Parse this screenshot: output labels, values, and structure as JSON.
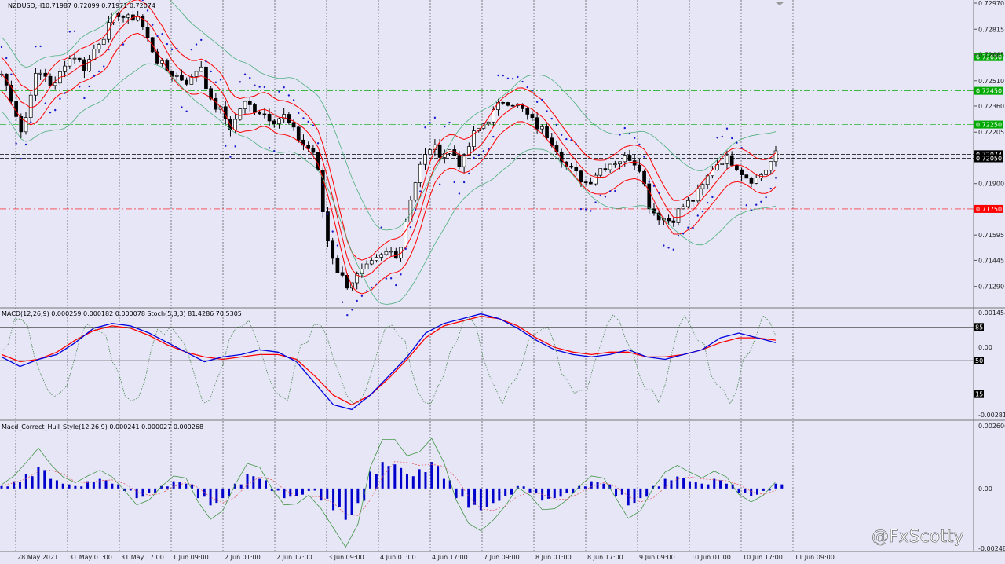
{
  "window": {
    "symbol_header": "NZDUSD,H1",
    "ohlc": "0.71987 0.72099 0.71971 0.72074"
  },
  "indicators": {
    "macd_stoch_header": "MACD(12,26,9) 0.000259 0.000182 0.000078  Stoch(5,3,3) 81.4286 70.5305",
    "macd_hull_header": "Macd_Correct_Hull_Style(12,26,9) 0.000241 0.000027 0.000268"
  },
  "watermark": "@FxScotty",
  "colors": {
    "background": "#e6e6f7",
    "grid": "#555555",
    "candle": "#000000",
    "envelope": "#ff0000",
    "bollinger": "#4caf7a",
    "psar": "#1a1acc",
    "macd_main": "#0000dd",
    "macd_signal": "#ff0000",
    "histogram": "#0000cc",
    "green_level": "#00aa00",
    "red_level": "#ff0000"
  },
  "chart_data": [
    {
      "type": "candlestick",
      "symbol": "NZDUSD",
      "timeframe": "H1",
      "ylim": [
        0.712,
        0.7297
      ],
      "y_ticks": [
        "0.72970",
        "0.72815",
        "0.72665",
        "0.72510",
        "0.72360",
        "0.72205",
        "0.71900",
        "0.71595",
        "0.71445",
        "0.71290"
      ],
      "x_ticks": [
        "28 May 2021",
        "31 May 01:00",
        "31 May 17:00",
        "1 Jun 09:00",
        "2 Jun 01:00",
        "2 Jun 17:00",
        "3 Jun 09:00",
        "4 Jun 01:00",
        "4 Jun 17:00",
        "7 Jun 09:00",
        "8 Jun 01:00",
        "8 Jun 17:00",
        "9 Jun 09:00",
        "10 Jun 01:00",
        "10 Jun 17:00",
        "11 Jun 09:00"
      ],
      "levels": [
        {
          "price": 0.7265,
          "label": "0.72650",
          "color": "#00aa00"
        },
        {
          "price": 0.7245,
          "label": "0.72450",
          "color": "#00aa00"
        },
        {
          "price": 0.7225,
          "label": "0.72250",
          "color": "#00aa00"
        },
        {
          "price": 0.7175,
          "label": "0.71750",
          "color": "#ff0000"
        },
        {
          "price": 0.72074,
          "label": "0.72074",
          "color": "#000000"
        },
        {
          "price": 0.7205,
          "label": "0.72050",
          "color": "#000000"
        }
      ],
      "close_path": [
        0.7255,
        0.724,
        0.7218,
        0.7252,
        0.7256,
        0.7246,
        0.7262,
        0.7266,
        0.7258,
        0.7272,
        0.728,
        0.7292,
        0.7287,
        0.729,
        0.7275,
        0.7262,
        0.7256,
        0.7253,
        0.725,
        0.7262,
        0.7238,
        0.7233,
        0.7222,
        0.7238,
        0.7235,
        0.7232,
        0.7228,
        0.723,
        0.722,
        0.7212,
        0.7208,
        0.716,
        0.714,
        0.713,
        0.7135,
        0.714,
        0.7145,
        0.715,
        0.7148,
        0.718,
        0.72,
        0.7212,
        0.7208,
        0.721,
        0.72,
        0.7218,
        0.7225,
        0.7232,
        0.724,
        0.7238,
        0.7232,
        0.7225,
        0.722,
        0.7212,
        0.72,
        0.7195,
        0.719,
        0.7198,
        0.7202,
        0.7204,
        0.7206,
        0.72,
        0.7175,
        0.717,
        0.7168,
        0.7176,
        0.718,
        0.7188,
        0.72,
        0.7205,
        0.7203,
        0.7195,
        0.7192,
        0.7198,
        0.7207
      ]
    },
    {
      "type": "line",
      "name": "MACD(12,26,9) / Stoch(5,3,3)",
      "ylim": [
        -0.002818,
        0.001454
      ],
      "y_ticks": [
        "0.001454",
        "0.00",
        "-0.002818"
      ],
      "stoch_levels": [
        "85",
        "50",
        "15"
      ],
      "macd_main": [
        -0.0004,
        -0.0008,
        -0.0005,
        -0.0003,
        0.0002,
        0.0008,
        0.001,
        0.0009,
        0.0006,
        0.0002,
        -0.0002,
        -0.0006,
        -0.0004,
        -0.0003,
        -0.0001,
        -0.0002,
        -0.0006,
        -0.0015,
        -0.0024,
        -0.0026,
        -0.002,
        -0.0012,
        -0.0004,
        0.0006,
        0.001,
        0.0012,
        0.0014,
        0.0012,
        0.0008,
        0.0003,
        -0.0001,
        -0.0003,
        -0.0004,
        -0.0003,
        -0.0001,
        -0.0004,
        -0.0005,
        -0.0003,
        -0.0001,
        0.0004,
        0.0006,
        0.0004,
        0.0002
      ],
      "macd_signal": [
        -0.0003,
        -0.0006,
        -0.0005,
        -0.0002,
        0.0003,
        0.0007,
        0.0009,
        0.0008,
        0.0005,
        0.0001,
        -0.0002,
        -0.0004,
        -0.0005,
        -0.0004,
        -0.0003,
        -0.0003,
        -0.0005,
        -0.0012,
        -0.002,
        -0.0024,
        -0.002,
        -0.0013,
        -0.0005,
        0.0004,
        0.0009,
        0.0011,
        0.0013,
        0.0012,
        0.0009,
        0.0004,
        0.0,
        -0.0002,
        -0.0003,
        -0.0002,
        -0.0002,
        -0.0004,
        -0.0004,
        -0.0003,
        -0.0001,
        0.0002,
        0.0004,
        0.0004,
        0.0003
      ]
    },
    {
      "type": "bar",
      "name": "Macd_Correct_Hull_Style(12,26,9)",
      "ylim": [
        -0.002485,
        0.002606
      ],
      "y_ticks": [
        "0.002606",
        "0.00",
        "-0.002485"
      ],
      "values": [
        0.0001,
        0.0003,
        0.0006,
        0.0009,
        0.0004,
        0.0002,
        0.0001,
        0.0003,
        0.0004,
        0.0002,
        -0.0001,
        -0.0004,
        -0.0002,
        0.0001,
        0.0003,
        0.0002,
        -0.0004,
        -0.0007,
        -0.0004,
        0.0002,
        0.0006,
        0.0004,
        -0.0001,
        -0.0004,
        -0.0003,
        -0.0001,
        -0.0005,
        -0.0009,
        -0.0013,
        -0.0006,
        0.0007,
        0.0011,
        0.001,
        0.0006,
        0.0008,
        0.0011,
        0.0004,
        -0.0004,
        -0.0008,
        -0.0009,
        -0.0006,
        -0.0003,
        0.0001,
        -0.0002,
        -0.0005,
        -0.0004,
        -0.0002,
        0.0001,
        0.0003,
        0.0002,
        -0.0003,
        -0.0007,
        -0.0004,
        0.0001,
        0.0004,
        0.0005,
        0.0003,
        0.0002,
        0.0004,
        0.0002,
        -0.0002,
        -0.0003,
        -0.0001,
        0.0002
      ]
    }
  ]
}
